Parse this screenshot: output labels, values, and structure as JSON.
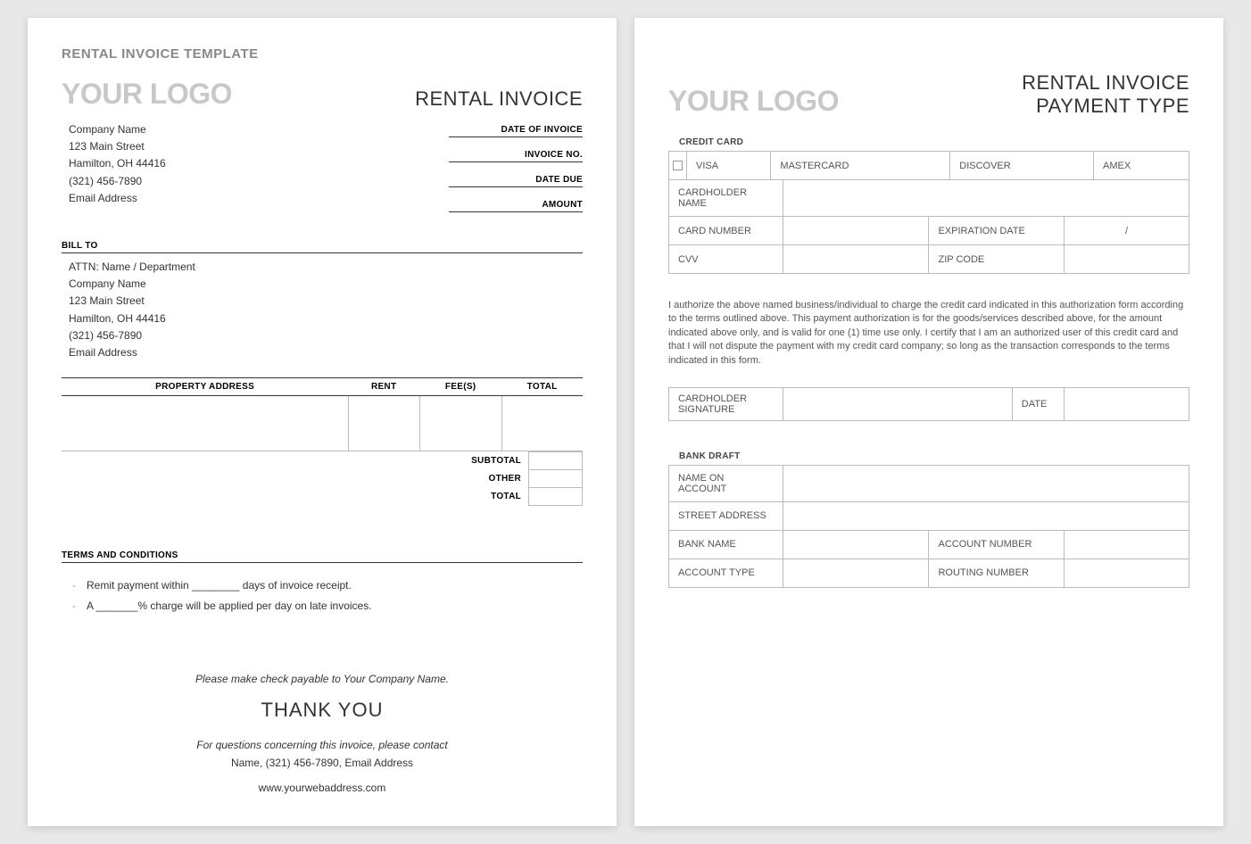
{
  "template_title": "RENTAL INVOICE TEMPLATE",
  "logo_text": "YOUR LOGO",
  "page1": {
    "doc_type": "RENTAL INVOICE",
    "company": {
      "name": "Company Name",
      "street": "123 Main Street",
      "city": "Hamilton, OH  44416",
      "phone": "(321) 456-7890",
      "email": "Email Address"
    },
    "meta": {
      "date_of_invoice": "DATE OF INVOICE",
      "invoice_no": "INVOICE NO.",
      "date_due": "DATE DUE",
      "amount": "AMOUNT"
    },
    "bill_to_label": "BILL TO",
    "bill_to": {
      "attn": "ATTN: Name / Department",
      "company": "Company Name",
      "street": "123 Main Street",
      "city": "Hamilton, OH  44416",
      "phone": "(321) 456-7890",
      "email": "Email Address"
    },
    "columns": {
      "property": "PROPERTY ADDRESS",
      "rent": "RENT",
      "fees": "FEE(S)",
      "total": "TOTAL"
    },
    "totals": {
      "subtotal": "SUBTOTAL",
      "other": "OTHER",
      "total": "TOTAL"
    },
    "terms_label": "TERMS AND CONDITIONS",
    "terms": [
      "Remit payment within ________ days of invoice receipt.",
      "A _______% charge will be applied per day on late invoices."
    ],
    "footer": {
      "payable": "Please make check payable to Your Company Name.",
      "thank_you": "THANK YOU",
      "contact1": "For questions concerning this invoice, please contact",
      "contact2": "Name, (321) 456-7890, Email Address",
      "web": "www.yourwebaddress.com"
    }
  },
  "page2": {
    "doc_type_line1": "RENTAL INVOICE",
    "doc_type_line2": "PAYMENT TYPE",
    "cc_label": "CREDIT CARD",
    "cards": {
      "visa": "VISA",
      "mc": "MASTERCARD",
      "disc": "DISCOVER",
      "amex": "AMEX"
    },
    "fields": {
      "cardholder": "CARDHOLDER NAME",
      "cardnumber": "CARD NUMBER",
      "expiration": "EXPIRATION DATE",
      "exp_sep": "/",
      "cvv": "CVV",
      "zip": "ZIP CODE"
    },
    "auth_text": "I authorize the above named business/individual to charge the credit card indicated in this authorization form according to the terms outlined above. This payment authorization is for the goods/services described above, for the amount indicated above only, and is valid for one (1) time use only. I certify that I am an authorized user of this credit card and that I will not dispute the payment with my credit card company; so long as the transaction corresponds to the terms indicated in this form.",
    "signature": {
      "sig": "CARDHOLDER SIGNATURE",
      "date": "DATE"
    },
    "bank_label": "BANK DRAFT",
    "bank": {
      "name_on_account": "NAME ON ACCOUNT",
      "street": "STREET ADDRESS",
      "bank_name": "BANK NAME",
      "account_number": "ACCOUNT NUMBER",
      "account_type": "ACCOUNT TYPE",
      "routing_number": "ROUTING NUMBER"
    }
  }
}
